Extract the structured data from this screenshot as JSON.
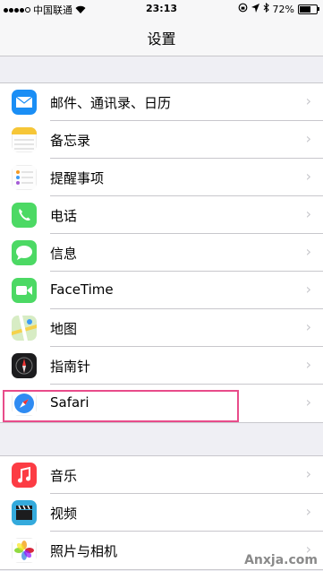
{
  "status_bar": {
    "carrier": "中国联通",
    "time": "23:13",
    "battery": "72%",
    "battery_level": 0.72
  },
  "nav": {
    "title": "设置"
  },
  "group1": [
    {
      "label": "邮件、通讯录、日历",
      "icon": "mail-icon"
    },
    {
      "label": "备忘录",
      "icon": "notes-icon"
    },
    {
      "label": "提醒事项",
      "icon": "reminders-icon"
    },
    {
      "label": "电话",
      "icon": "phone-icon"
    },
    {
      "label": "信息",
      "icon": "messages-icon"
    },
    {
      "label": "FaceTime",
      "icon": "facetime-icon"
    },
    {
      "label": "地图",
      "icon": "maps-icon"
    },
    {
      "label": "指南针",
      "icon": "compass-icon"
    },
    {
      "label": "Safari",
      "icon": "safari-icon"
    }
  ],
  "group2": [
    {
      "label": "音乐",
      "icon": "music-icon"
    },
    {
      "label": "视频",
      "icon": "videos-icon"
    },
    {
      "label": "照片与相机",
      "icon": "photos-icon"
    }
  ],
  "watermark": {
    "text": "Anxja.com"
  }
}
